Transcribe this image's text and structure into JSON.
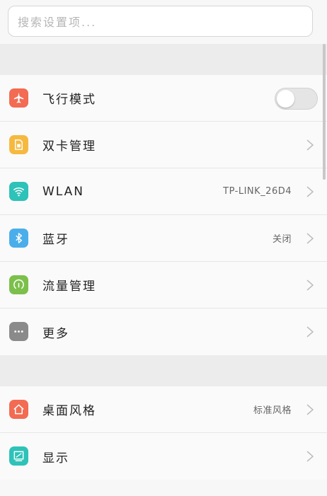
{
  "search": {
    "placeholder": "搜索设置项..."
  },
  "section1": [
    {
      "id": "airplane",
      "label": "飞行模式",
      "icon": "airplane-icon",
      "color": "#f26b52",
      "control": "toggle",
      "toggle_on": false
    },
    {
      "id": "dual-sim",
      "label": "双卡管理",
      "icon": "sim-card-icon",
      "color": "#f6b940",
      "control": "chevron"
    },
    {
      "id": "wlan",
      "label": "WLAN",
      "value": "TP-LINK_26D4",
      "icon": "wifi-icon",
      "color": "#2ec2b8",
      "control": "chevron"
    },
    {
      "id": "bluetooth",
      "label": "蓝牙",
      "value": "关闭",
      "icon": "bluetooth-icon",
      "color": "#4aaeea",
      "control": "chevron"
    },
    {
      "id": "data-usage",
      "label": "流量管理",
      "icon": "data-usage-icon",
      "color": "#7cc04b",
      "control": "chevron"
    },
    {
      "id": "more",
      "label": "更多",
      "icon": "more-icon",
      "color": "#8a8a8a",
      "control": "chevron"
    }
  ],
  "section2": [
    {
      "id": "desktop-style",
      "label": "桌面风格",
      "value": "标准风格",
      "icon": "home-icon",
      "color": "#f26b52",
      "control": "chevron"
    },
    {
      "id": "display",
      "label": "显示",
      "icon": "display-icon",
      "color": "#2ec2b8",
      "control": "chevron"
    }
  ]
}
